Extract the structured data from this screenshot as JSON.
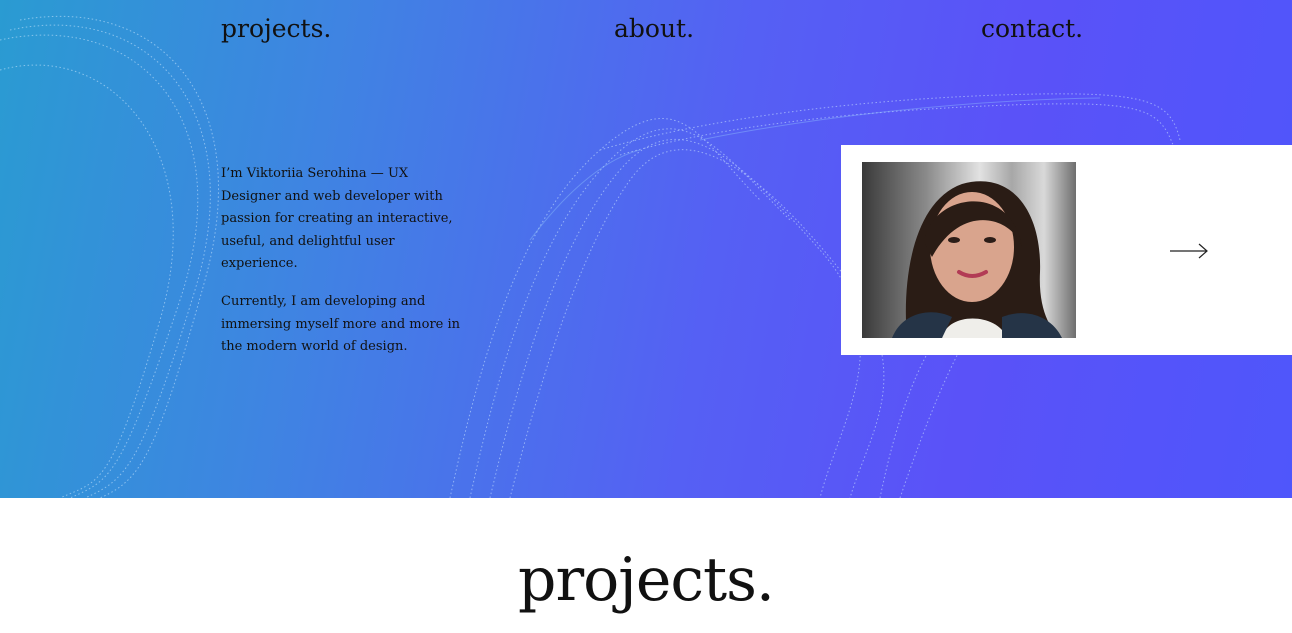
{
  "nav": {
    "projects": "projects.",
    "about": "about.",
    "contact": "contact."
  },
  "intro": {
    "paragraph1": "I’m Viktoriia Serohina — UX Designer and web developer with passion for creating an interactive, useful, and delightful user experience.",
    "paragraph2": "Currently, I am developing and immersing myself more and more in the modern world of design."
  },
  "card": {
    "photo_icon": "portrait-photo",
    "arrow_icon": "arrow-right-icon"
  },
  "projects_section": {
    "title": "projects."
  },
  "colors": {
    "gradient_start": "#2a9bd2",
    "gradient_mid": "#5560f4",
    "gradient_end": "#4f56fb",
    "text": "#111111",
    "card_bg": "#ffffff"
  }
}
